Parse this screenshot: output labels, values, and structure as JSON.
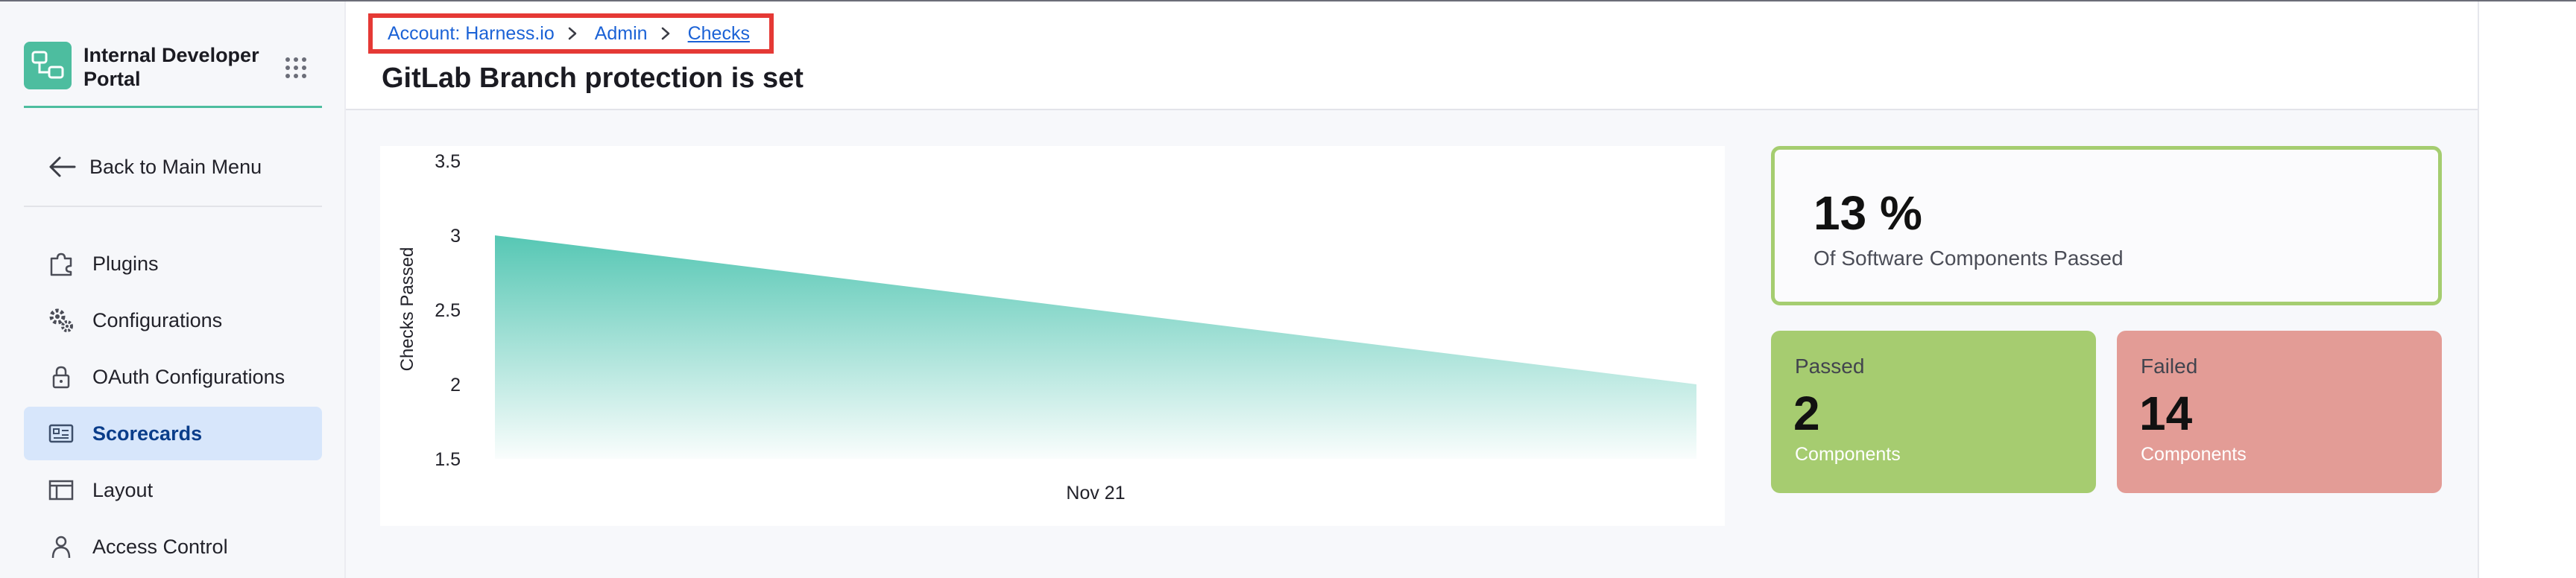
{
  "app": {
    "title": "Internal Developer Portal"
  },
  "sidebar": {
    "back_label": "Back to Main Menu",
    "items": [
      {
        "label": "Plugins",
        "icon": "puzzle-icon",
        "active": false
      },
      {
        "label": "Configurations",
        "icon": "gears-icon",
        "active": false
      },
      {
        "label": "OAuth Configurations",
        "icon": "lock-icon",
        "active": false
      },
      {
        "label": "Scorecards",
        "icon": "scorecard-icon",
        "active": true
      },
      {
        "label": "Layout",
        "icon": "layout-icon",
        "active": false
      },
      {
        "label": "Access Control",
        "icon": "user-icon",
        "active": false
      }
    ]
  },
  "breadcrumb": {
    "items": [
      "Account: Harness.io",
      "Admin",
      "Checks"
    ]
  },
  "page": {
    "title": "GitLab Branch protection is set"
  },
  "chart_data": {
    "type": "area",
    "ylabel": "Checks Passed",
    "xtick_labels": [
      "Nov 21"
    ],
    "yticks": [
      "3.5",
      "3",
      "2.5",
      "2",
      "1.5"
    ],
    "ylim": [
      1.5,
      3.5
    ],
    "x": [
      0,
      1
    ],
    "values": [
      3,
      2
    ],
    "grid": false,
    "color": "#5ccbb8"
  },
  "stats": {
    "percent_value": "13 %",
    "percent_label": "Of Software Components Passed",
    "passed": {
      "title": "Passed",
      "value": "2",
      "sub": "Components"
    },
    "failed": {
      "title": "Failed",
      "value": "14",
      "sub": "Components"
    }
  },
  "colors": {
    "accent": "#4dbd9f",
    "link": "#1b62d6",
    "active_bg": "#d7e6fb",
    "passed": "#a6cc70",
    "failed": "#e39c96",
    "highlight_border": "#e53935"
  }
}
